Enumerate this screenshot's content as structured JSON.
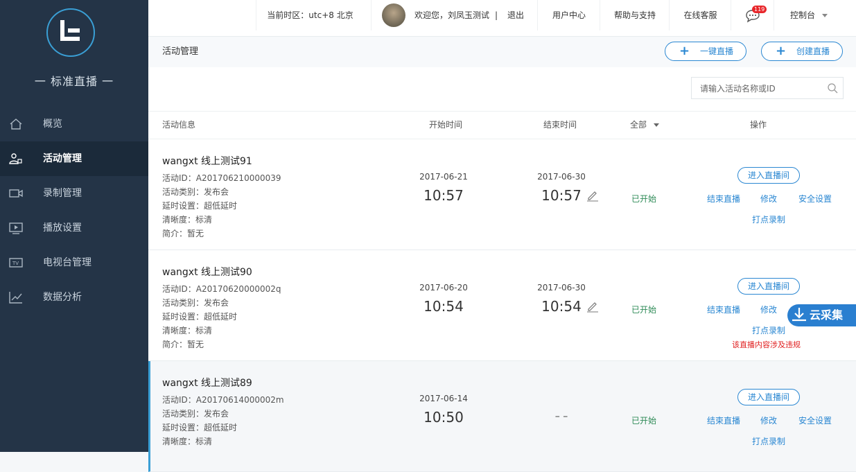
{
  "sidebar": {
    "brand": "一  标准直播  一",
    "items": [
      {
        "label": "概览",
        "icon": "home-icon",
        "active": false
      },
      {
        "label": "活动管理",
        "icon": "user-camera-icon",
        "active": true
      },
      {
        "label": "录制管理",
        "icon": "video-camera-icon",
        "active": false
      },
      {
        "label": "播放设置",
        "icon": "play-screen-icon",
        "active": false
      },
      {
        "label": "电视台管理",
        "icon": "tv-icon",
        "active": false
      },
      {
        "label": "数据分析",
        "icon": "chart-icon",
        "active": false
      }
    ]
  },
  "topbar": {
    "timezone": "当前时区：utc+8 北京",
    "welcome": "欢迎您，刘凤玉测试",
    "separator": "|",
    "logout": "退出",
    "user_center": "用户中心",
    "help": "帮助与支持",
    "service": "在线客服",
    "message_count": "119",
    "console": "控制台"
  },
  "page": {
    "title": "活动管理",
    "one_click_live": "一键直播",
    "create_live": "创建直播",
    "search_placeholder": "请输入活动名称或ID"
  },
  "table": {
    "headers": {
      "info": "活动信息",
      "start": "开始时间",
      "end": "结束时间",
      "filter": "全部",
      "ops": "操作"
    },
    "labels": {
      "id": "活动ID：",
      "category": "活动类别：",
      "delay": "延时设置：",
      "clarity": "清晰度：",
      "intro": "简介："
    },
    "actions": {
      "enter": "进入直播间",
      "end": "结束直播",
      "edit": "修改",
      "security": "安全设置",
      "mark": "打点录制"
    },
    "rows": [
      {
        "title": "wangxt 线上测试91",
        "id": "A201706210000039",
        "category": "发布会",
        "delay": "超低延时",
        "clarity": "标清",
        "intro": "暂无",
        "start_date": "2017-06-21",
        "start_time": "10:57",
        "end_date": "2017-06-30",
        "end_time": "10:57",
        "status": "已开始"
      },
      {
        "title": "wangxt 线上测试90",
        "id": "A20170620000002q",
        "category": "发布会",
        "delay": "超低延时",
        "clarity": "标清",
        "intro": "暂无",
        "start_date": "2017-06-20",
        "start_time": "10:54",
        "end_date": "2017-06-30",
        "end_time": "10:54",
        "status": "已开始",
        "warning": "该直播内容涉及违规"
      },
      {
        "title": "wangxt 线上测试89",
        "id": "A20170614000002m",
        "category": "发布会",
        "delay": "超低延时",
        "clarity": "标清",
        "start_date": "2017-06-14",
        "start_time": "10:50",
        "end_placeholder": "– –",
        "status": "已开始"
      }
    ]
  },
  "overlay": {
    "cloud_label": "云采集"
  },
  "colors": {
    "sidebar": "#243447",
    "accent": "#2a87d2",
    "status": "#2e8b57",
    "warning": "#e02020"
  }
}
